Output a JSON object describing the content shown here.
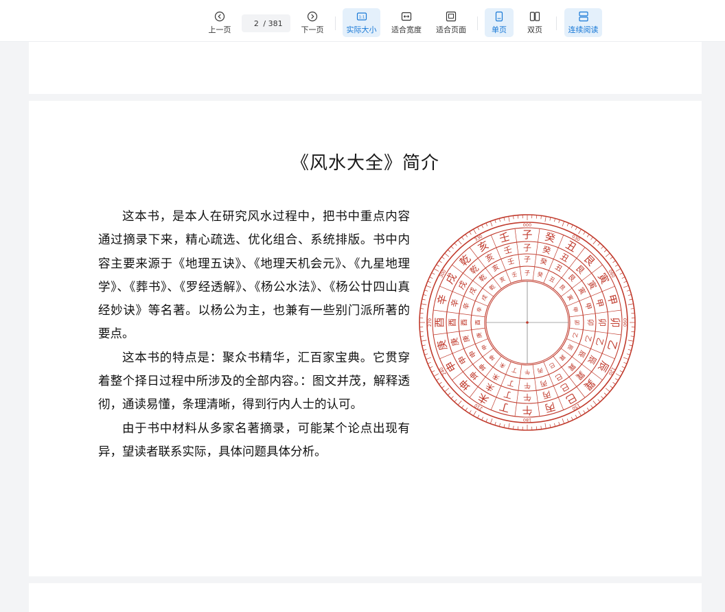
{
  "toolbar": {
    "prev_label": "上一页",
    "current_page": "2",
    "total_pages": "/ 381",
    "next_label": "下一页",
    "actual_size_label": "实际大小",
    "fit_width_label": "适合宽度",
    "fit_page_label": "适合页面",
    "single_page_label": "单页",
    "double_page_label": "双页",
    "continuous_label": "连续阅读",
    "accent_color": "#1677d6",
    "active_bg": "#e4f0fb"
  },
  "document": {
    "title": "《风水大全》简介",
    "paragraphs": [
      "这本书，是本人在研究风水过程中，把书中重点内容通过摘录下来，精心疏选、优化组合、系统排版。书中内容主要来源于《地理五诀》、《地理天机会元》、《九星地理学》、《葬书》、《罗经透解》、《杨公水法》、《杨公廿四山真经妙诀》等名著。以杨公为主，也兼有一些别门派所著的要点。",
      "这本书的特点是：聚众书精华，汇百家宝典。它贯穿着整个择日过程中所涉及的全部内容。：图文并茂，解释透彻，通读易懂，条理清晰，得到行内人士的认可。",
      "由于书中材料从多家名著摘录，可能某个论点出现有异，望读者联系实际，具体问题具体分析。"
    ]
  },
  "compass": {
    "color": "#c0392b",
    "mountains": [
      "子",
      "癸",
      "丑",
      "艮",
      "寅",
      "甲",
      "卯",
      "乙",
      "辰",
      "巽",
      "巳",
      "丙",
      "午",
      "丁",
      "未",
      "坤",
      "申",
      "庚",
      "酉",
      "辛",
      "戌",
      "乾",
      "亥",
      "壬"
    ],
    "degree_labels": [
      "000",
      "030",
      "060",
      "090",
      "120",
      "150",
      "180",
      "210",
      "240",
      "270",
      "300",
      "330"
    ]
  }
}
